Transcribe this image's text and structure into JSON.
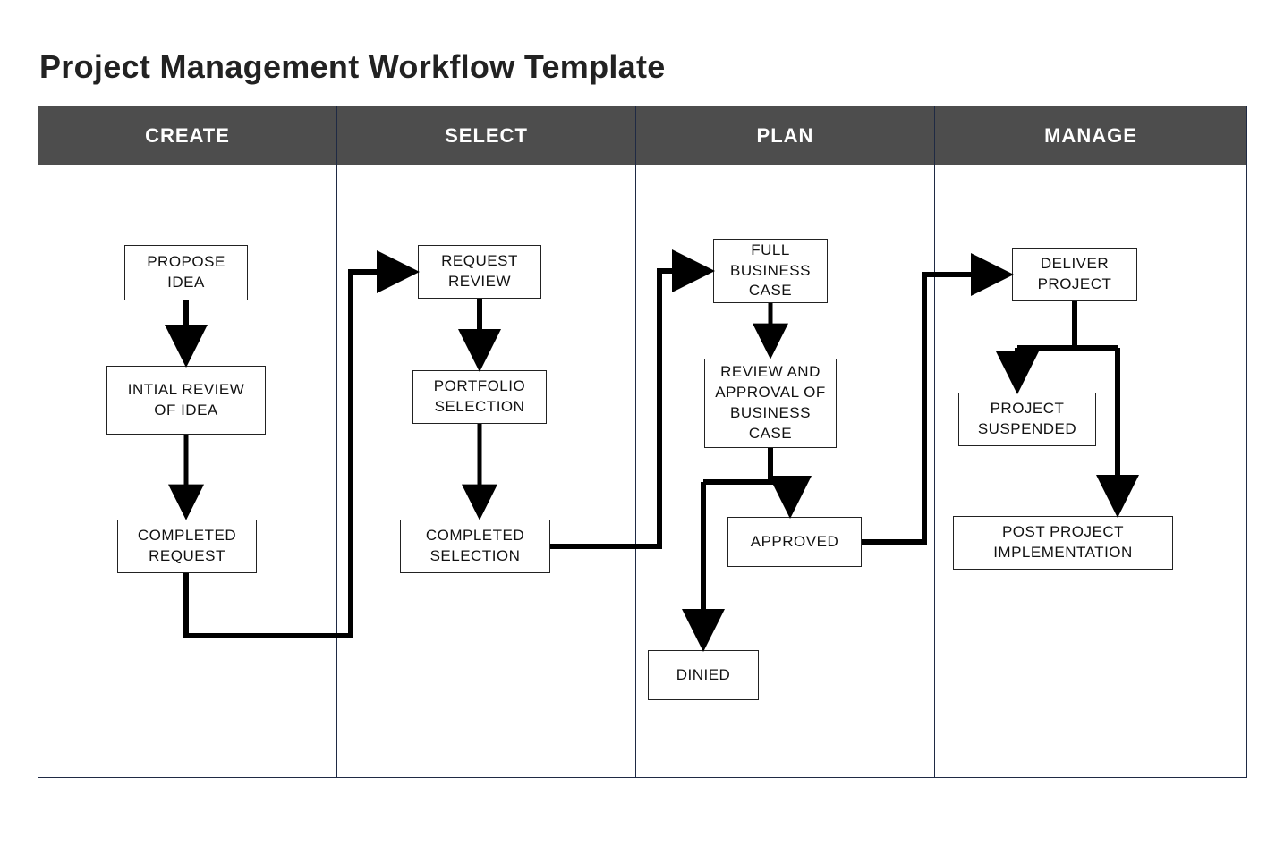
{
  "title": "Project Management Workflow Template",
  "lanes": {
    "create": {
      "header": "CREATE"
    },
    "select": {
      "header": "SELECT"
    },
    "plan": {
      "header": "PLAN"
    },
    "manage": {
      "header": "MANAGE"
    }
  },
  "boxes": {
    "propose_idea": "PROPOSE IDEA",
    "initial_review": "INTIAL REVIEW OF IDEA",
    "completed_request": "COMPLETED REQUEST",
    "request_review": "REQUEST REVIEW",
    "portfolio_selection": "PORTFOLIO SELECTION",
    "completed_selection": "COMPLETED SELECTION",
    "full_business_case": "FULL BUSINESS CASE",
    "review_approval_bc": "REVIEW AND APPROVAL OF BUSINESS CASE",
    "approved": "APPROVED",
    "denied": "DINIED",
    "deliver_project": "DELIVER PROJECT",
    "project_suspended": "PROJECT SUSPENDED",
    "post_project_impl": "POST PROJECT IMPLEMENTATION"
  },
  "colors": {
    "header_bg": "#4d4d4d",
    "header_fg": "#ffffff",
    "lane_border": "#1f2a44",
    "box_border": "#222222",
    "connector": "#000000"
  }
}
